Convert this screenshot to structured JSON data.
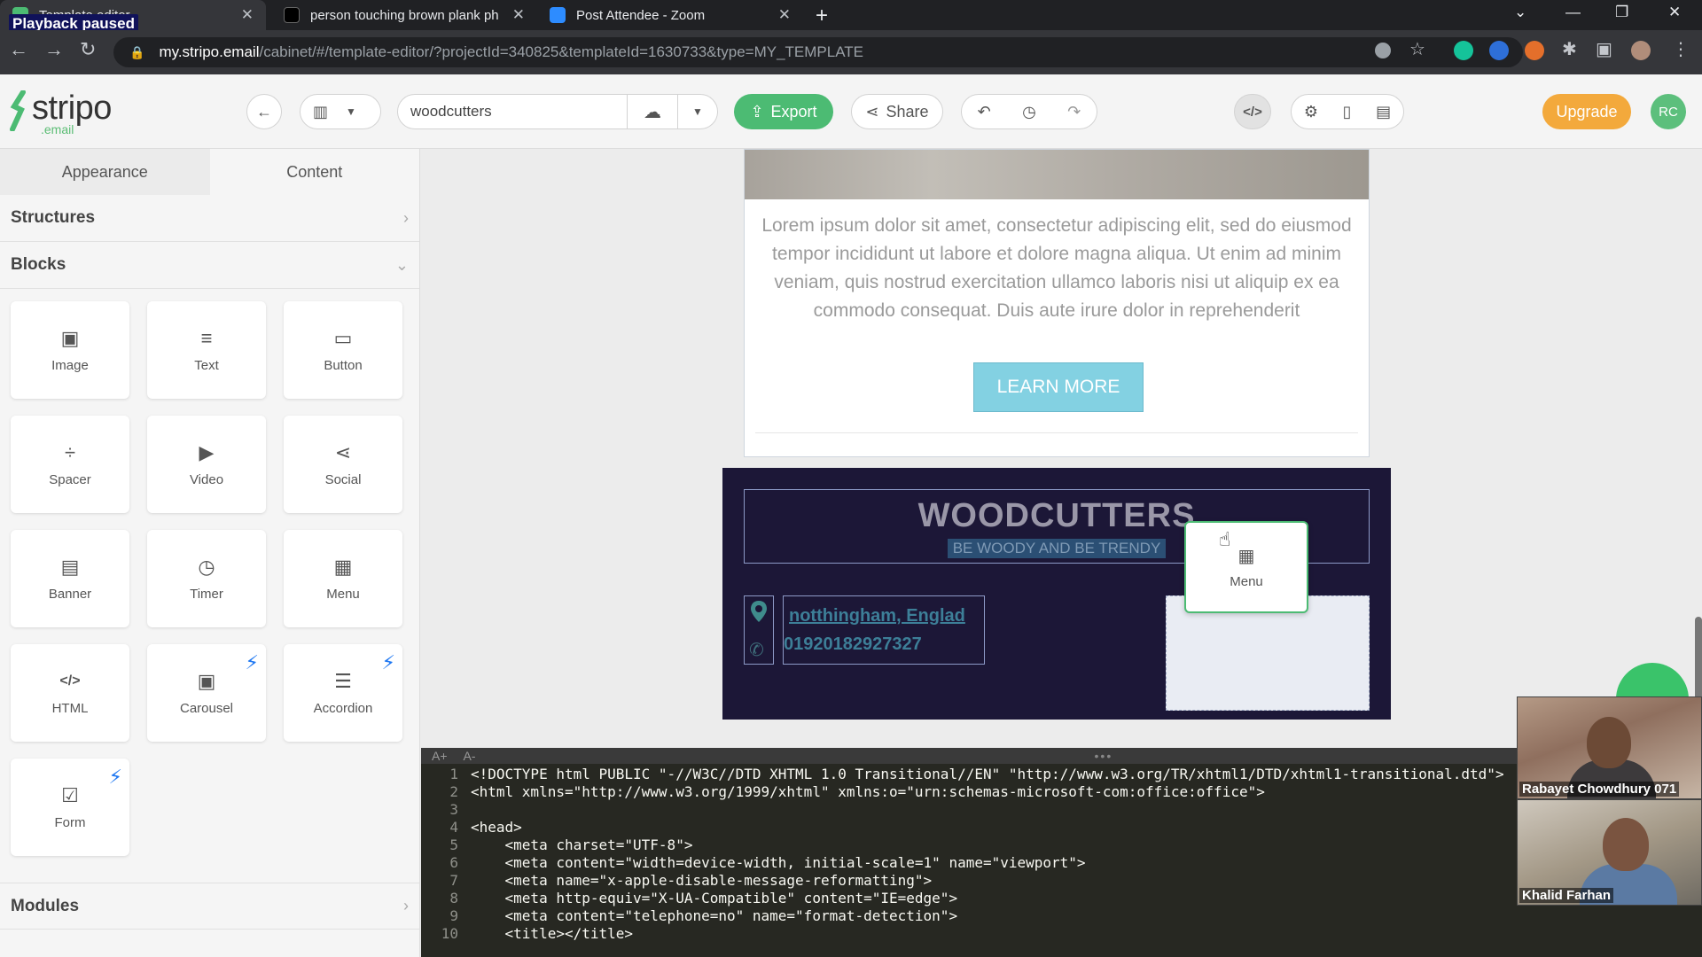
{
  "browser": {
    "playback_overlay": "Playback paused",
    "tabs": [
      {
        "title": "Template editor",
        "active": true
      },
      {
        "title": "person touching brown plank ph",
        "active": false
      },
      {
        "title": "Post Attendee - Zoom",
        "active": false
      }
    ],
    "url_host": "my.stripo.email",
    "url_path": "/cabinet/#/template-editor/?projectId=340825&templateId=1630733&type=MY_TEMPLATE"
  },
  "header": {
    "logo_text": "stripo",
    "logo_sub": ".email",
    "template_name": "woodcutters",
    "export_label": "Export",
    "share_label": "Share",
    "upgrade_label": "Upgrade",
    "avatar_initials": "RC"
  },
  "sidebar": {
    "tabs": [
      "Appearance",
      "Content"
    ],
    "active_tab": "Content",
    "sections": {
      "structures": "Structures",
      "blocks": "Blocks",
      "modules": "Modules"
    },
    "blocks": [
      {
        "label": "Image",
        "icon": "image-icon"
      },
      {
        "label": "Text",
        "icon": "text-icon"
      },
      {
        "label": "Button",
        "icon": "button-icon"
      },
      {
        "label": "Spacer",
        "icon": "spacer-icon"
      },
      {
        "label": "Video",
        "icon": "video-icon"
      },
      {
        "label": "Social",
        "icon": "share-icon"
      },
      {
        "label": "Banner",
        "icon": "banner-icon"
      },
      {
        "label": "Timer",
        "icon": "timer-icon"
      },
      {
        "label": "Menu",
        "icon": "menu-icon"
      },
      {
        "label": "HTML",
        "icon": "code-icon"
      },
      {
        "label": "Carousel",
        "icon": "carousel-icon",
        "amp": true
      },
      {
        "label": "Accordion",
        "icon": "accordion-icon",
        "amp": true
      },
      {
        "label": "Form",
        "icon": "form-icon",
        "amp": true
      }
    ]
  },
  "canvas": {
    "lorem": "Lorem ipsum dolor sit amet, consectetur adipiscing elit, sed do eiusmod tempor incididunt ut labore et dolore magna aliqua. Ut enim ad minim veniam, quis nostrud exercitation ullamco laboris nisi ut aliquip ex ea commodo consequat. Duis aute irure dolor in reprehenderit",
    "learn_more": "LEARN MORE",
    "footer_title": "WOODCUTTERS",
    "footer_tagline": "BE WOODY AND BE TRENDY",
    "location": "notthingham, Englad",
    "phone": "01920182927327",
    "drag_block_label": "Menu"
  },
  "code_editor": {
    "font_up": "A+",
    "font_down": "A-",
    "lines": [
      {
        "n": "1",
        "text": "<!DOCTYPE html PUBLIC \"-//W3C//DTD XHTML 1.0 Transitional//EN\" \"http://www.w3.org/TR/xhtml1/DTD/xhtml1-transitional.dtd\">"
      },
      {
        "n": "2",
        "text": "<html xmlns=\"http://www.w3.org/1999/xhtml\" xmlns:o=\"urn:schemas-microsoft-com:office:office\">"
      },
      {
        "n": "3",
        "text": ""
      },
      {
        "n": "4",
        "text": "<head>"
      },
      {
        "n": "5",
        "text": "    <meta charset=\"UTF-8\">"
      },
      {
        "n": "6",
        "text": "    <meta content=\"width=device-width, initial-scale=1\" name=\"viewport\">"
      },
      {
        "n": "7",
        "text": "    <meta name=\"x-apple-disable-message-reformatting\">"
      },
      {
        "n": "8",
        "text": "    <meta http-equiv=\"X-UA-Compatible\" content=\"IE=edge\">"
      },
      {
        "n": "9",
        "text": "    <meta content=\"telephone=no\" name=\"format-detection\">"
      },
      {
        "n": "10",
        "text": "    <title></title>"
      }
    ]
  },
  "video_participants": [
    "Rabayet Chowdhury 071",
    "Khalid Farhan"
  ]
}
